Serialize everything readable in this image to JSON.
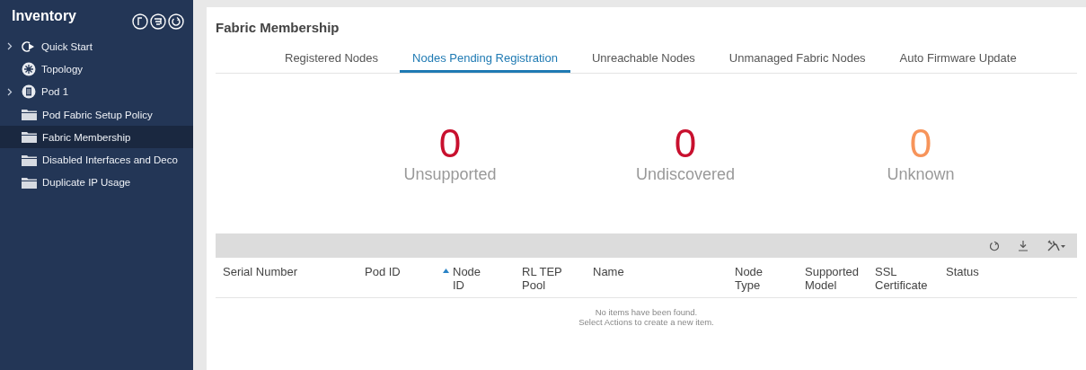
{
  "sidebar": {
    "title": "Inventory",
    "items": [
      {
        "label": "Quick Start",
        "kind": "quickstart",
        "expandable": true,
        "selected": false
      },
      {
        "label": "Topology",
        "kind": "topology",
        "expandable": false,
        "selected": false
      },
      {
        "label": "Pod 1",
        "kind": "pod",
        "expandable": true,
        "selected": false
      },
      {
        "label": "Pod Fabric Setup Policy",
        "kind": "folder",
        "expandable": false,
        "selected": false
      },
      {
        "label": "Fabric Membership",
        "kind": "folder",
        "expandable": false,
        "selected": true
      },
      {
        "label": "Disabled Interfaces and Deco",
        "kind": "folder",
        "expandable": false,
        "selected": false
      },
      {
        "label": "Duplicate IP Usage",
        "kind": "folder",
        "expandable": false,
        "selected": false
      }
    ]
  },
  "page_title": "Fabric Membership",
  "tabs": [
    {
      "label": "Registered Nodes",
      "selected": false
    },
    {
      "label": "Nodes Pending Registration",
      "selected": true
    },
    {
      "label": "Unreachable Nodes",
      "selected": false
    },
    {
      "label": "Unmanaged Fabric Nodes",
      "selected": false
    },
    {
      "label": "Auto Firmware Update",
      "selected": false
    }
  ],
  "counters": [
    {
      "value": "0",
      "label": "Unsupported",
      "color": "#c8102e"
    },
    {
      "value": "0",
      "label": "Undiscovered",
      "color": "#c8102e"
    },
    {
      "value": "0",
      "label": "Unknown",
      "color": "#f7945a"
    }
  ],
  "table": {
    "columns": [
      {
        "label": "Serial Number",
        "sorted": false
      },
      {
        "label": "Pod ID",
        "sorted": false
      },
      {
        "label": "Node\nID",
        "sorted": true
      },
      {
        "label": "RL TEP\nPool",
        "sorted": false
      },
      {
        "label": "Name",
        "sorted": false
      },
      {
        "label": "Node\nType",
        "sorted": false
      },
      {
        "label": "Supported\nModel",
        "sorted": false
      },
      {
        "label": "SSL\nCertificate",
        "sorted": false
      },
      {
        "label": "Status",
        "sorted": false
      }
    ],
    "empty_message": [
      "No items have been found.",
      "Select Actions to create a new item."
    ]
  }
}
